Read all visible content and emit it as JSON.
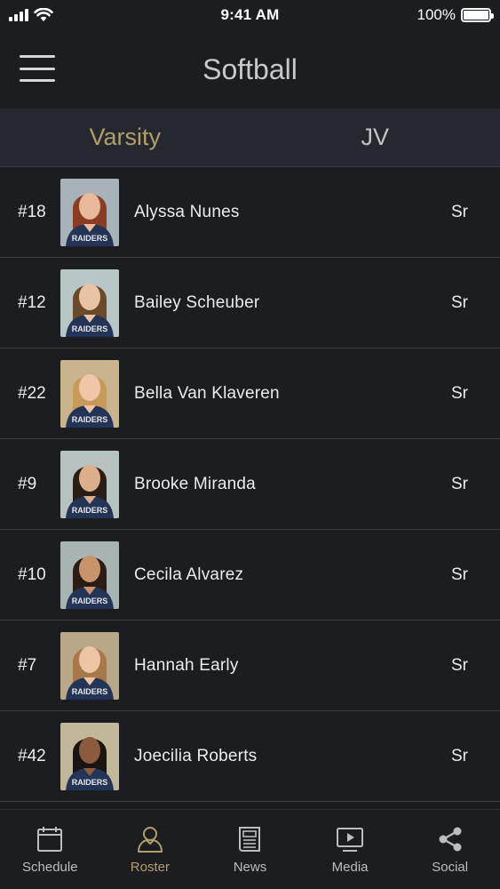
{
  "status_bar": {
    "time": "9:41 AM",
    "battery": "100%",
    "battery_level": 1.0
  },
  "header": {
    "title": "Softball"
  },
  "tabs": [
    {
      "label": "Varsity",
      "selected": true
    },
    {
      "label": "JV",
      "selected": false
    }
  ],
  "roster": [
    {
      "number": "#18",
      "name": "Alyssa Nunes",
      "year": "Sr",
      "hair": "#8a3d22",
      "skin": "#e8b99a",
      "bg": "#a7b3b8"
    },
    {
      "number": "#12",
      "name": "Bailey Scheuber",
      "year": "Sr",
      "hair": "#6b4a2a",
      "skin": "#e9c3a6",
      "bg": "#b9c6c8"
    },
    {
      "number": "#22",
      "name": "Bella Van Klaveren",
      "year": "Sr",
      "hair": "#c89a5a",
      "skin": "#efc7a8",
      "bg": "#c9b48e"
    },
    {
      "number": "#9",
      "name": "Brooke Miranda",
      "year": "Sr",
      "hair": "#2a1d16",
      "skin": "#dcae8c",
      "bg": "#b6c2c0"
    },
    {
      "number": "#10",
      "name": "Cecila Alvarez",
      "year": "Sr",
      "hair": "#2b1c15",
      "skin": "#c9946c",
      "bg": "#a8b4b2"
    },
    {
      "number": "#7",
      "name": "Hannah Early",
      "year": "Sr",
      "hair": "#a6784a",
      "skin": "#edc4a4",
      "bg": "#b8a888"
    },
    {
      "number": "#42",
      "name": "Joecilia Roberts",
      "year": "Sr",
      "hair": "#1a1412",
      "skin": "#8c5a3c",
      "bg": "#c2b79a"
    }
  ],
  "jersey": {
    "text": "RAIDERS",
    "color": "#243457"
  },
  "tabbar": [
    {
      "label": "Schedule",
      "icon": "calendar-icon",
      "active": false
    },
    {
      "label": "Roster",
      "icon": "person-icon",
      "active": true
    },
    {
      "label": "News",
      "icon": "newspaper-icon",
      "active": false
    },
    {
      "label": "Media",
      "icon": "play-screen-icon",
      "active": false
    },
    {
      "label": "Social",
      "icon": "share-icon",
      "active": false
    }
  ],
  "colors": {
    "accent": "#b39e6a",
    "background": "#1c1d21",
    "tab_bar_bg": "#25282e"
  }
}
